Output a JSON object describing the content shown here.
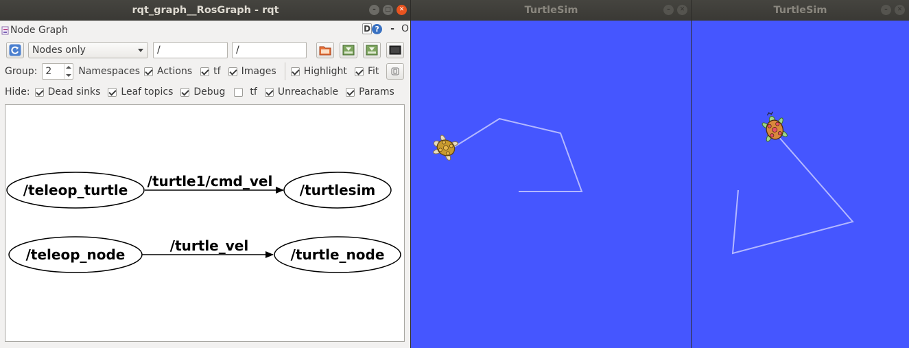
{
  "rqt": {
    "title": "rqt_graph__RosGraph - rqt",
    "plugin_title": "Node Graph",
    "plugin_controls": {
      "d_label": "D",
      "help_label": "?",
      "minimize": "-",
      "close": "O"
    },
    "toolbar": {
      "mode_select": "Nodes only",
      "node_filter": "/",
      "topic_filter": "/"
    },
    "group_row": {
      "group_label": "Group:",
      "group_value": "2",
      "namespaces_label": "Namespaces",
      "actions_label": "Actions",
      "tf_label": "tf",
      "images_label": "Images",
      "highlight_label": "Highlight",
      "fit_label": "Fit",
      "checks": {
        "namespaces": true,
        "actions": true,
        "tf": true,
        "images": true,
        "highlight": true,
        "fit": true
      }
    },
    "hide_row": {
      "hide_label": "Hide:",
      "dead_sinks_label": "Dead sinks",
      "leaf_topics_label": "Leaf topics",
      "debug_label": "Debug",
      "tf_label": "tf",
      "unreachable_label": "Unreachable",
      "params_label": "Params",
      "checks": {
        "dead_sinks": true,
        "leaf_topics": true,
        "debug": true,
        "tf": false,
        "unreachable": true,
        "params": true
      }
    },
    "graph": {
      "nodes": [
        "/teleop_turtle",
        "/turtlesim",
        "/teleop_node",
        "/turtle_node"
      ],
      "edges": [
        {
          "from": "/teleop_turtle",
          "to": "/turtlesim",
          "label": "/turtle1/cmd_vel"
        },
        {
          "from": "/teleop_node",
          "to": "/turtle_node",
          "label": "/turtle_vel"
        }
      ]
    }
  },
  "turtlesim_1": {
    "title": "TurtleSim",
    "background": "#4556ff"
  },
  "turtlesim_2": {
    "title": "TurtleSim",
    "background": "#4556ff"
  },
  "colors": {
    "titlebar": "#3c3b37",
    "close_active": "#e95420",
    "panel": "#f2f1f0",
    "pen": "#b3b8ff"
  }
}
